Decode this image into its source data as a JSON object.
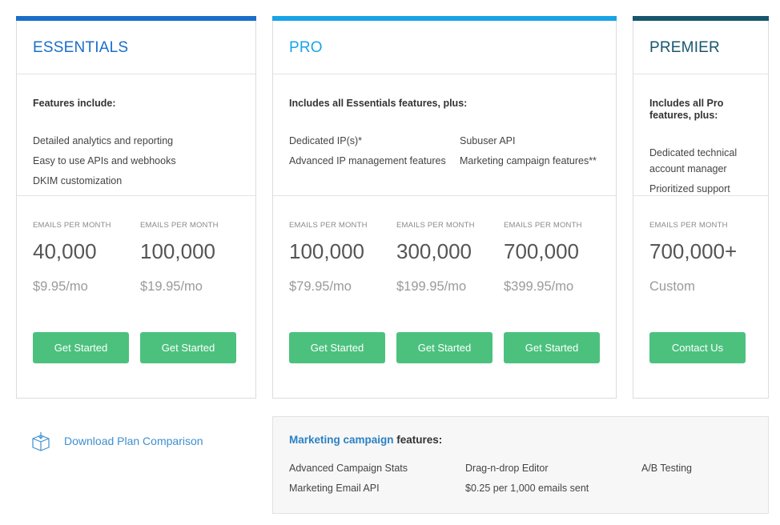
{
  "colors": {
    "essentials_bar": "#1a6fc8",
    "pro_bar": "#19a3e8",
    "premier_bar": "#17566e",
    "button": "#4cc17e",
    "link": "#3d8fd0"
  },
  "plans": {
    "essentials": {
      "title": "ESSENTIALS",
      "features_title": "Features include:",
      "features": [
        "Detailed analytics and reporting",
        "Easy to use APIs and webhooks",
        "DKIM customization"
      ],
      "tiers": [
        {
          "label": "EMAILS PER MONTH",
          "emails": "40,000",
          "price": "$9.95/mo",
          "button": "Get Started"
        },
        {
          "label": "EMAILS PER MONTH",
          "emails": "100,000",
          "price": "$19.95/mo",
          "button": "Get Started"
        }
      ]
    },
    "pro": {
      "title": "PRO",
      "features_title": "Includes all Essentials features, plus:",
      "features": [
        "Dedicated IP(s)*",
        "Advanced IP management features",
        "Subuser API",
        "Marketing campaign features**"
      ],
      "tiers": [
        {
          "label": "EMAILS PER MONTH",
          "emails": "100,000",
          "price": "$79.95/mo",
          "button": "Get Started"
        },
        {
          "label": "EMAILS PER MONTH",
          "emails": "300,000",
          "price": "$199.95/mo",
          "button": "Get Started"
        },
        {
          "label": "EMAILS PER MONTH",
          "emails": "700,000",
          "price": "$399.95/mo",
          "button": "Get Started"
        }
      ]
    },
    "premier": {
      "title": "PREMIER",
      "features_title_1": "Includes all Pro",
      "features_title_2": "features, plus:",
      "features": [
        "Dedicated technical",
        "account manager",
        "Prioritized support"
      ],
      "tiers": [
        {
          "label": "EMAILS PER MONTH",
          "emails": "700,000+",
          "price": "Custom",
          "button": "Contact Us"
        }
      ]
    }
  },
  "download": {
    "icon": "box-icon",
    "label": "Download Plan Comparison"
  },
  "marketing": {
    "title_highlight": "Marketing campaign",
    "title_rest": " features:",
    "items": [
      "Advanced Campaign Stats",
      "Marketing Email API",
      "Drag-n-drop Editor",
      "$0.25 per 1,000 emails sent",
      "A/B Testing"
    ]
  }
}
